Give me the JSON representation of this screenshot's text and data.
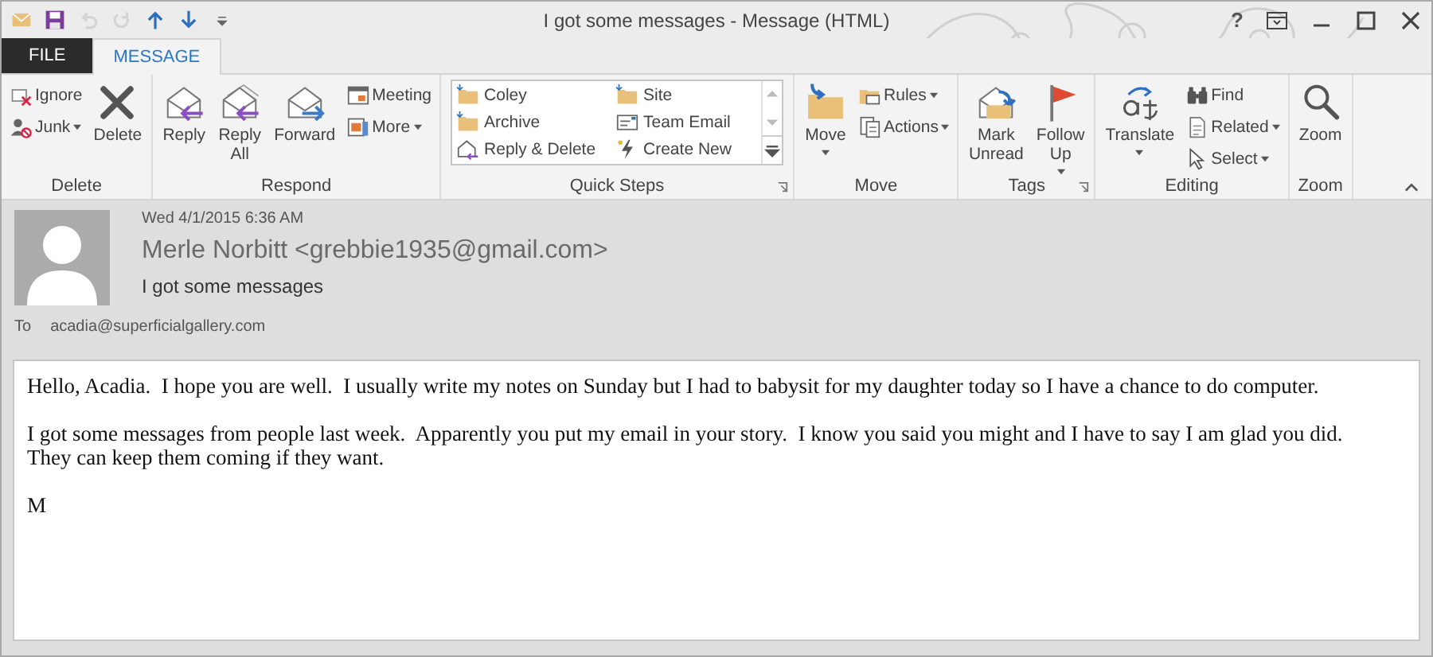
{
  "quick_access": [
    {
      "disabled": false
    },
    {
      "disabled": false
    },
    {
      "disabled": true
    },
    {
      "disabled": true
    },
    {
      "disabled": false
    },
    {
      "disabled": false
    },
    {
      "disabled": false
    }
  ],
  "window": {
    "title": "I got some messages - Message (HTML)",
    "help": "?"
  },
  "tabs": [
    {
      "label": "FILE",
      "kind": "file",
      "selected": false
    },
    {
      "label": "MESSAGE",
      "kind": "tab",
      "selected": true
    }
  ],
  "ribbon": {
    "groups": [
      {
        "label": "Delete",
        "launcher": false,
        "controls": [
          {
            "kind": "stack",
            "items": [
              {
                "label": "Ignore",
                "dropdown": false
              },
              {
                "label": "Junk",
                "dropdown": true
              }
            ]
          },
          {
            "kind": "large",
            "label": "Delete",
            "dropdown": false
          }
        ]
      },
      {
        "label": "Respond",
        "launcher": false,
        "controls": [
          {
            "kind": "large",
            "label": "Reply",
            "dropdown": false
          },
          {
            "kind": "large",
            "label": "Reply All",
            "dropdown": false
          },
          {
            "kind": "large",
            "label": "Forward",
            "dropdown": false
          },
          {
            "kind": "stack",
            "items": [
              {
                "label": "Meeting",
                "dropdown": false
              },
              {
                "label": "More",
                "dropdown": true
              }
            ]
          }
        ]
      },
      {
        "label": "Quick Steps",
        "launcher": true,
        "controls": [
          {
            "kind": "gallery",
            "items": [
              {
                "label": "Coley"
              },
              {
                "label": "Archive"
              },
              {
                "label": "Reply & Delete"
              },
              {
                "label": "Site"
              },
              {
                "label": "Team Email"
              },
              {
                "label": "Create New"
              }
            ]
          }
        ]
      },
      {
        "label": "Move",
        "launcher": false,
        "controls": [
          {
            "kind": "large",
            "label": "Move",
            "dropdown": true
          },
          {
            "kind": "stack",
            "items": [
              {
                "label": "Rules",
                "dropdown": true
              },
              {
                "label": "Actions",
                "dropdown": true
              }
            ]
          }
        ]
      },
      {
        "label": "Tags",
        "launcher": true,
        "controls": [
          {
            "kind": "large",
            "label": "Mark Unread",
            "dropdown": false
          },
          {
            "kind": "large",
            "label": "Follow Up",
            "dropdown": true
          }
        ]
      },
      {
        "label": "Editing",
        "launcher": false,
        "controls": [
          {
            "kind": "large",
            "label": "Translate",
            "dropdown": true
          },
          {
            "kind": "stack",
            "items": [
              {
                "label": "Find",
                "dropdown": false
              },
              {
                "label": "Related",
                "dropdown": true
              },
              {
                "label": "Select",
                "dropdown": true
              }
            ]
          }
        ]
      },
      {
        "label": "Zoom",
        "launcher": false,
        "controls": [
          {
            "kind": "large",
            "label": "Zoom",
            "dropdown": false
          }
        ]
      }
    ]
  },
  "message": {
    "date": "Wed 4/1/2015 6:36 AM",
    "sender": "Merle Norbitt <grebbie1935@gmail.com>",
    "subject": "I got some messages",
    "to_label": "To",
    "to": "acadia@superficialgallery.com"
  },
  "body": [
    "Hello, Acadia.  I hope you are well.  I usually write my notes on Sunday but I had to babysit for my daughter today so I have a chance to do computer.",
    "I got some messages from people last week.  Apparently you put my email in your story.  I know you said you might and I have to say I am glad you did.  They can keep them coming if they want.",
    "M"
  ]
}
